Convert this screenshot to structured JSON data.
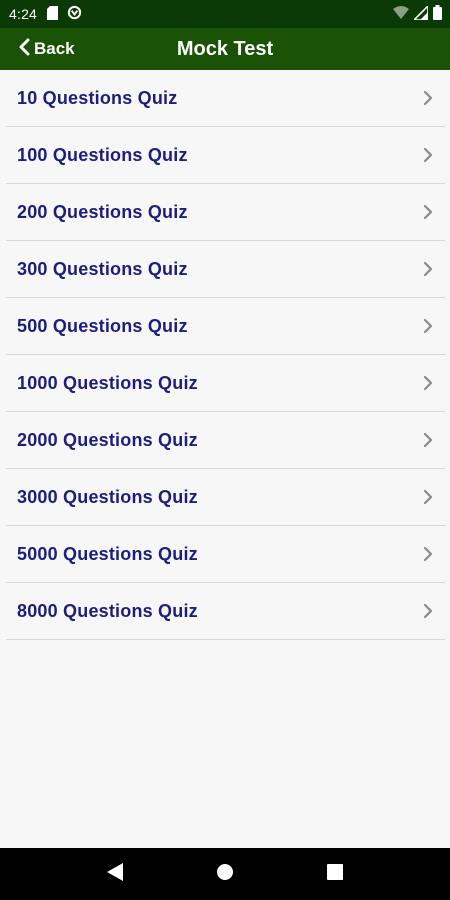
{
  "status_bar": {
    "time": "4:24",
    "left_icons": [
      "sd-card-icon",
      "data-saver-icon"
    ],
    "right_icons": [
      "wifi-icon",
      "cell-signal-icon",
      "battery-icon"
    ]
  },
  "app_bar": {
    "back_label": "Back",
    "title": "Mock Test",
    "background": "#1a5206"
  },
  "quiz_list": {
    "text_color": "#1c1e7e",
    "items": [
      {
        "label": "10 Questions Quiz"
      },
      {
        "label": "100 Questions Quiz"
      },
      {
        "label": "200 Questions Quiz"
      },
      {
        "label": "300 Questions Quiz"
      },
      {
        "label": "500 Questions Quiz"
      },
      {
        "label": "1000 Questions Quiz"
      },
      {
        "label": "2000 Questions Quiz"
      },
      {
        "label": "3000 Questions Quiz"
      },
      {
        "label": "5000 Questions Quiz"
      },
      {
        "label": "8000 Questions Quiz"
      }
    ]
  },
  "nav_bar": {
    "buttons": [
      "back-triangle-icon",
      "home-circle-icon",
      "recents-square-icon"
    ]
  }
}
